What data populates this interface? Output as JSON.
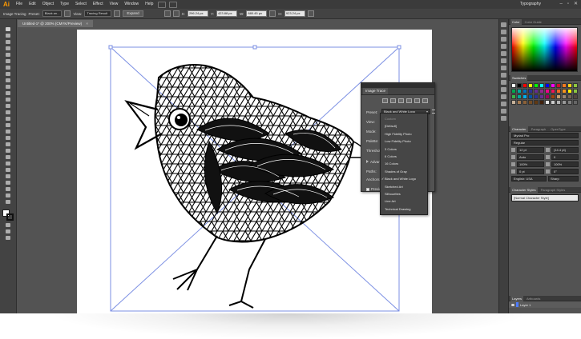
{
  "app": {
    "logo": "Ai"
  },
  "menu": [
    "File",
    "Edit",
    "Object",
    "Type",
    "Select",
    "Effect",
    "View",
    "Window",
    "Help"
  ],
  "workspace": "Typography",
  "window_controls": [
    "–",
    "▫",
    "✕"
  ],
  "controlbar": {
    "mode_label": "Image Tracing",
    "preset_label": "Preset:",
    "preset_value": "Black an...",
    "view_label": "View:",
    "view_value": "Tracing Result",
    "expand_label": "Expand",
    "x_value": "296.24 px",
    "y_value": "423.88 px",
    "w_value": "880.45 px",
    "h_value": "923.24 px"
  },
  "document_tab": {
    "title": "Untitled-1* @ 200% (CMYK/Preview)",
    "close": "×"
  },
  "image_trace": {
    "tab": "Image Trace",
    "preset_label": "Preset:",
    "preset_value": "Black and White Logo",
    "view_label": "View:",
    "mode_label": "Mode:",
    "palette_label": "Palette:",
    "threshold_label": "Threshold:",
    "advanced_label": "Advanced",
    "paths_label": "Paths:",
    "anchors_label": "Anchors:",
    "preview_label": "Preview"
  },
  "preset_menu": {
    "options": [
      {
        "label": "Custom",
        "disabled": true
      },
      {
        "label": "[Default]"
      },
      {
        "label": "High Fidelity Photo"
      },
      {
        "label": "Low Fidelity Photo"
      },
      {
        "label": "3 Colors"
      },
      {
        "label": "6 Colors"
      },
      {
        "label": "16 Colors"
      },
      {
        "label": "Shades of Gray"
      },
      {
        "label": "Black and White Logo",
        "checked": true
      },
      {
        "label": "Sketched Art"
      },
      {
        "label": "Silhouettes"
      },
      {
        "label": "Line Art"
      },
      {
        "label": "Technical Drawing"
      }
    ]
  },
  "color_panel": {
    "tabs": [
      "Color",
      "Color Guide"
    ]
  },
  "swatches_panel": {
    "tab": "Swatches",
    "colors": [
      "#ffffff",
      "#000000",
      "#ff0000",
      "#ffff00",
      "#00ff00",
      "#00ffff",
      "#0000ff",
      "#ff00ff",
      "#c8102e",
      "#f47920",
      "#fcd116",
      "#8dc63f",
      "#00a651",
      "#00a99d",
      "#0072bc",
      "#2e3192",
      "#662d91",
      "#92278f",
      "#ec008c",
      "#ed145b",
      "#f26522",
      "#f7941d",
      "#fff200",
      "#8cc63f",
      "#39b54a",
      "#00a99d",
      "#00aeef",
      "#0054a6",
      "#2e3192",
      "#662d91",
      "#9e005d",
      "#a0410d",
      "#c69c6d",
      "#998675",
      "#736357",
      "#534741",
      "#c7b299",
      "#a67c52",
      "#8c6239",
      "#754c24",
      "#603913",
      "#42210b",
      "#e6e6e6",
      "#cccccc",
      "#b3b3b3",
      "#999999",
      "#808080",
      "#666666"
    ]
  },
  "character_panel": {
    "tabs": [
      "Character",
      "Paragraph",
      "OpenType"
    ],
    "font_family": "Myriad Pro",
    "font_style": "Regular",
    "font_size": "12 pt",
    "leading": "(14.4 pt)",
    "tracking": "0",
    "kerning": "Auto",
    "scale_v": "100%",
    "scale_h": "100%",
    "baseline": "0 pt",
    "rotation": "0°",
    "language": "English: USA",
    "antialias": "Sharp"
  },
  "character_styles": {
    "tabs": [
      "Character Styles",
      "Paragraph Styles"
    ],
    "item": "[Normal Character Style]"
  },
  "layers_panel": {
    "tabs": [
      "Layers",
      "Artboards"
    ],
    "layer_name": "Layer 1"
  }
}
